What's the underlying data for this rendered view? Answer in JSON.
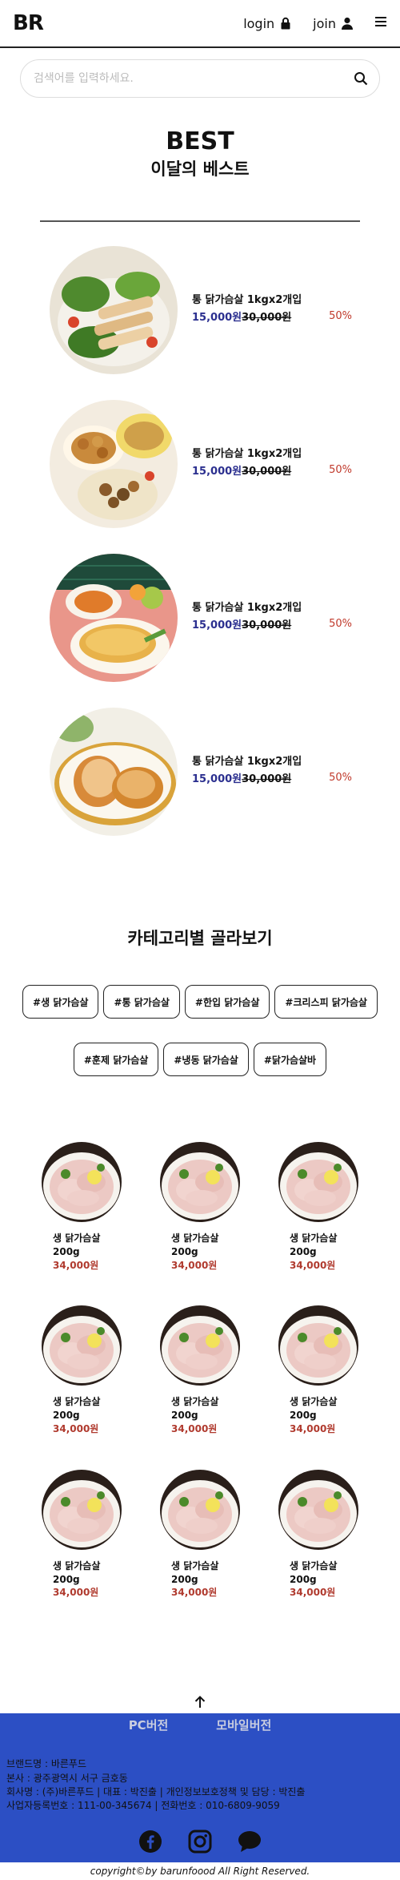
{
  "header": {
    "logo": "BR",
    "login_label": "login",
    "join_label": "join"
  },
  "search": {
    "placeholder": "검색어를 입력하세요."
  },
  "best": {
    "title": "BEST",
    "subtitle": "이달의 베스트",
    "items": [
      {
        "name": "통 닭가슴살 1kgx2개입",
        "price": "15,000원",
        "old_price": "30,000원",
        "discount": "50%"
      },
      {
        "name": "통 닭가슴살 1kgx2개입",
        "price": "15,000원",
        "old_price": "30,000원",
        "discount": "50%"
      },
      {
        "name": "통 닭가슴살 1kgx2개입",
        "price": "15,000원",
        "old_price": "30,000원",
        "discount": "50%"
      },
      {
        "name": "통 닭가슴살 1kgx2개입",
        "price": "15,000원",
        "old_price": "30,000원",
        "discount": "50%"
      }
    ]
  },
  "category": {
    "title": "카테고리별 골라보기",
    "tags": [
      "#생 닭가슴살",
      "#통 닭가슴살",
      "#한입 닭가슴살",
      "#크리스피 닭가슴살",
      "#훈제 닭가슴살",
      "#냉동 닭가슴살",
      "#닭가슴살바"
    ]
  },
  "products": [
    {
      "name": "생 닭가슴살",
      "weight": "200g",
      "price": "34,000원"
    },
    {
      "name": "생 닭가슴살",
      "weight": "200g",
      "price": "34,000원"
    },
    {
      "name": "생 닭가슴살",
      "weight": "200g",
      "price": "34,000원"
    },
    {
      "name": "생 닭가슴살",
      "weight": "200g",
      "price": "34,000원"
    },
    {
      "name": "생 닭가슴살",
      "weight": "200g",
      "price": "34,000원"
    },
    {
      "name": "생 닭가슴살",
      "weight": "200g",
      "price": "34,000원"
    },
    {
      "name": "생 닭가슴살",
      "weight": "200g",
      "price": "34,000원"
    },
    {
      "name": "생 닭가슴살",
      "weight": "200g",
      "price": "34,000원"
    },
    {
      "name": "생 닭가슴살",
      "weight": "200g",
      "price": "34,000원"
    }
  ],
  "footer": {
    "tab_pc": "PC버전",
    "tab_mobile": "모바일버전",
    "lines": [
      "브랜드명 : 바른푸드",
      "본사 : 광주광역시 서구 금호동",
      "회사명 : (주)바른푸드 | 대표 : 박진출 | 개인정보보호정책 및 담당 : 박진출",
      "사업자등록번호 : 111-00-345674 | 전화번호 : 010-6809-9059"
    ],
    "copyright": "copyright©by barunfoood All Right Reserved.",
    "background": "#2c4fc4"
  },
  "colors": {
    "price": "#2b2f8f",
    "discount": "#c0392b",
    "card_price": "#b03a2e"
  }
}
